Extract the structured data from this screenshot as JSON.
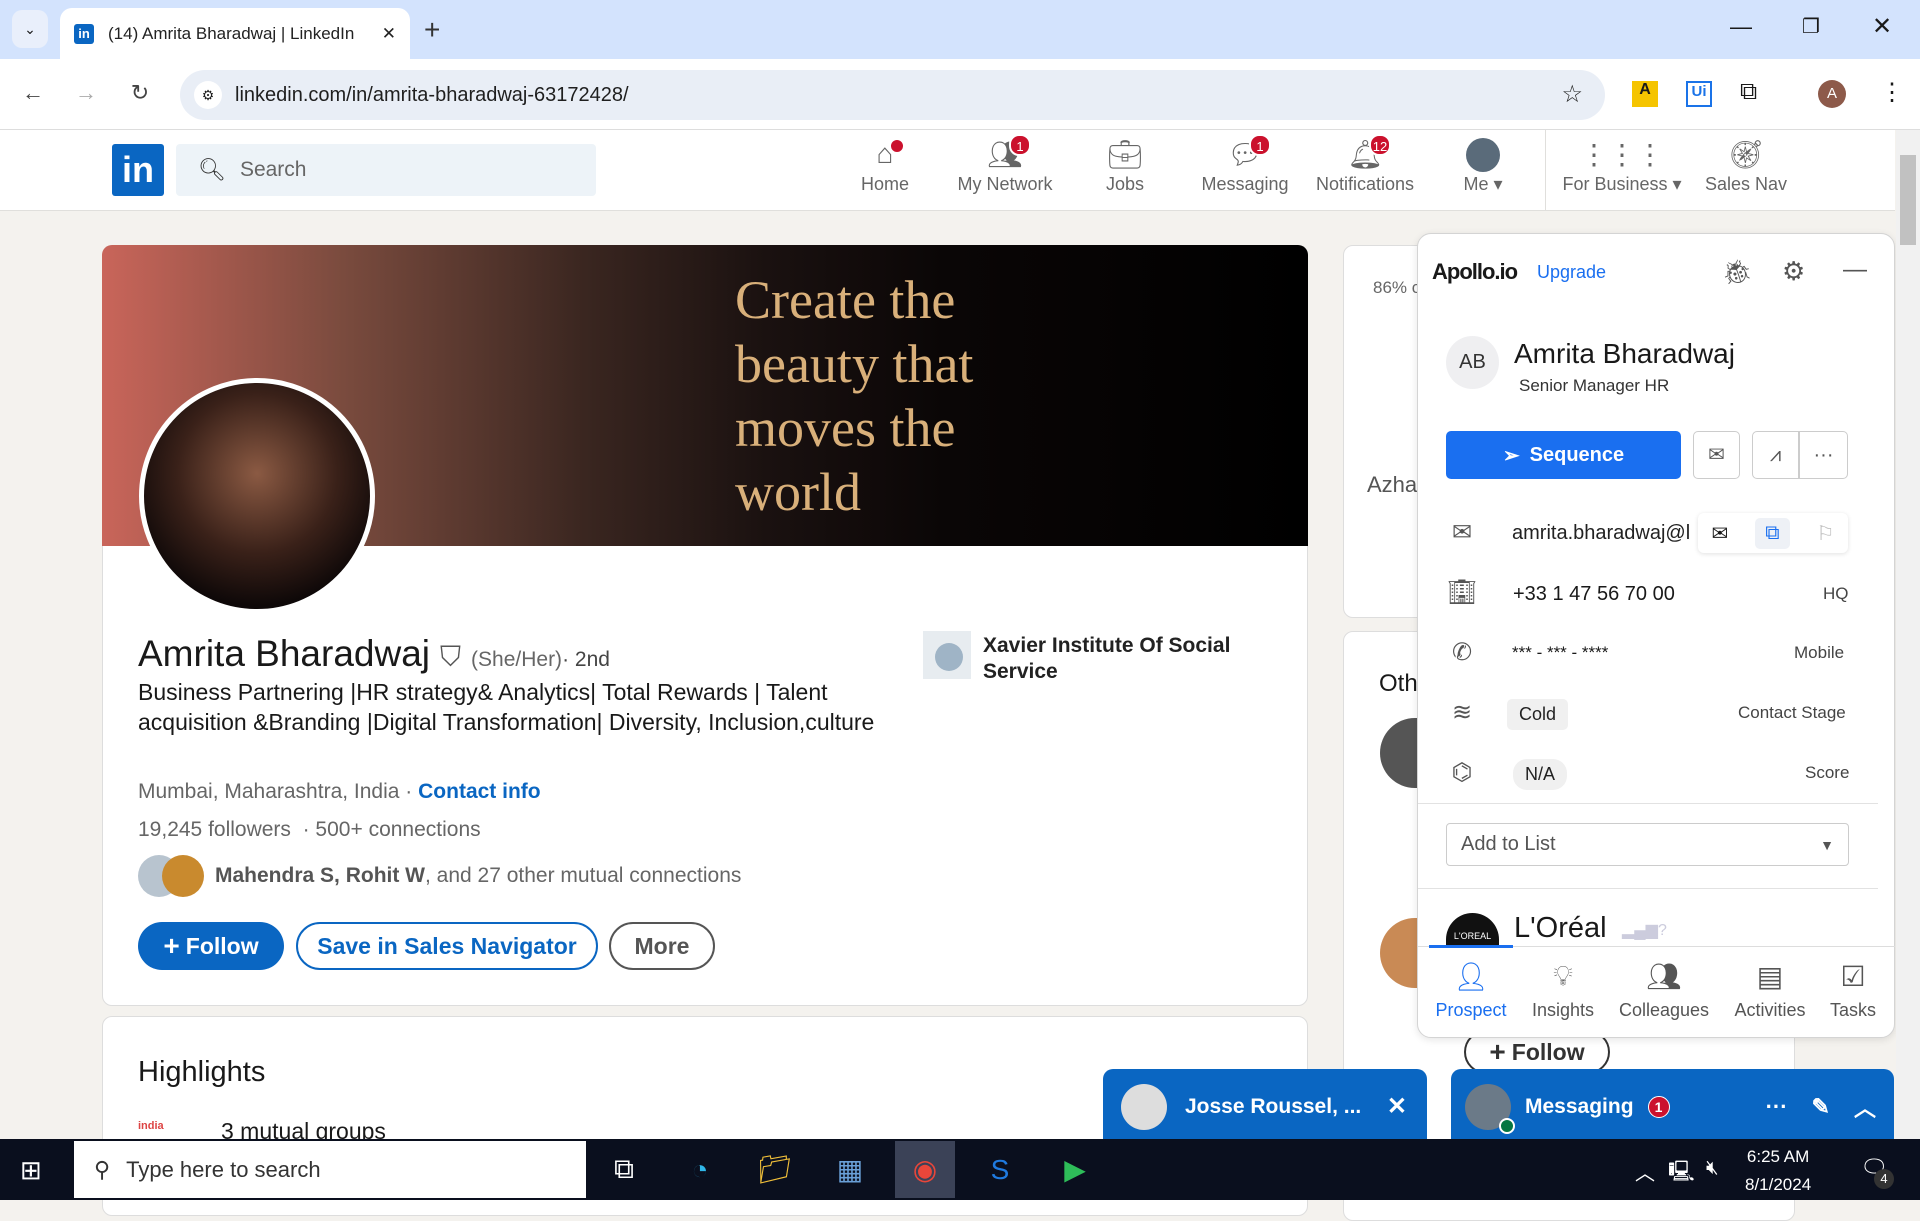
{
  "browser": {
    "tab_title": "(14) Amrita Bharadwaj | LinkedIn",
    "url": "linkedin.com/in/amrita-bharadwaj-63172428/",
    "profile_initial": "A"
  },
  "linkedin": {
    "search_placeholder": "Search",
    "nav": [
      {
        "label": "Home",
        "badge": ""
      },
      {
        "label": "My Network",
        "badge": "1"
      },
      {
        "label": "Jobs",
        "badge": ""
      },
      {
        "label": "Messaging",
        "badge": "1"
      },
      {
        "label": "Notifications",
        "badge": "12"
      },
      {
        "label": "Me ▾",
        "badge": ""
      },
      {
        "label": "For Business ▾",
        "badge": ""
      },
      {
        "label": "Sales Nav",
        "badge": ""
      }
    ]
  },
  "profile": {
    "banner_text": "Create the beauty that moves the world",
    "name": "Amrita Bharadwaj",
    "pronouns": "(She/Her)",
    "degree": " · 2nd",
    "headline": "Business Partnering |HR strategy& Analytics| Total Rewards | Talent acquisition &Branding |Digital Transformation| Diversity, Inclusion,culture",
    "location": "Mumbai, Maharashtra, India · ",
    "contact_info": "Contact info",
    "followers": "19,245 followers",
    "connections": "· 500+ connections",
    "mutual_names": "Mahendra S, Rohit W",
    "mutual_rest": ", and 27 other mutual connections",
    "school": "Xavier Institute Of Social Service",
    "follow": "Follow",
    "save_sales_nav": "Save in Sales Navigator",
    "more": "More"
  },
  "highlights": {
    "title": "Highlights",
    "item": "3 mutual groups"
  },
  "right_col": {
    "percent": "86% c",
    "name_partial": "Azha",
    "other_partial": "Oth",
    "follow": "Follow"
  },
  "apollo": {
    "logo": "Apollo.io",
    "upgrade": "Upgrade",
    "initials": "AB",
    "name": "Amrita Bharadwaj",
    "title": "Senior Manager HR",
    "sequence": "Sequence",
    "email": "amrita.bharadwaj@l",
    "phone": "+33 1 47 56 70 00",
    "phone_label": "HQ",
    "mobile": "*** - *** - ****",
    "mobile_label": "Mobile",
    "stage": "Cold",
    "stage_label": "Contact Stage",
    "score": "N/A",
    "score_label": "Score",
    "add_to_list": "Add to List",
    "company": "L'Oréal",
    "company_logo": "L'OREAL",
    "tabs": [
      "Prospect",
      "Insights",
      "Colleagues",
      "Activities",
      "Tasks"
    ],
    "accent": "#1a6ff0"
  },
  "messaging": {
    "chat_name": "Josse Roussel, ...",
    "title": "Messaging",
    "badge": "1"
  },
  "taskbar": {
    "search_placeholder": "Type here to search",
    "time": "6:25 AM",
    "date": "8/1/2024",
    "notifications": "4"
  }
}
